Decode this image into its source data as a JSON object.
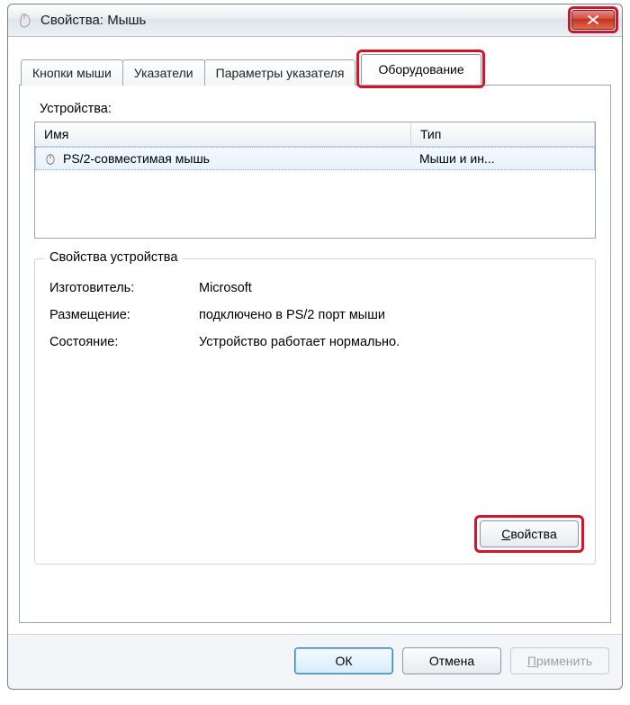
{
  "window": {
    "title": "Свойства: Мышь"
  },
  "tabs": {
    "buttons": "Кнопки мыши",
    "pointers": "Указатели",
    "options": "Параметры указателя",
    "hardware": "Оборудование"
  },
  "devices": {
    "section_label": "Устройства:",
    "col_name": "Имя",
    "col_type": "Тип",
    "row": {
      "name": "PS/2-совместимая мышь",
      "type": "Мыши и ин..."
    }
  },
  "props": {
    "group_title": "Свойства устройства",
    "manufacturer_label": "Изготовитель:",
    "manufacturer_value": "Microsoft",
    "location_label": "Размещение:",
    "location_value": "подключено в PS/2 порт мыши",
    "status_label": "Состояние:",
    "status_value": "Устройство работает нормально.",
    "props_button": "Свойства"
  },
  "footer": {
    "ok": "ОК",
    "cancel": "Отмена",
    "apply": "Применить"
  }
}
